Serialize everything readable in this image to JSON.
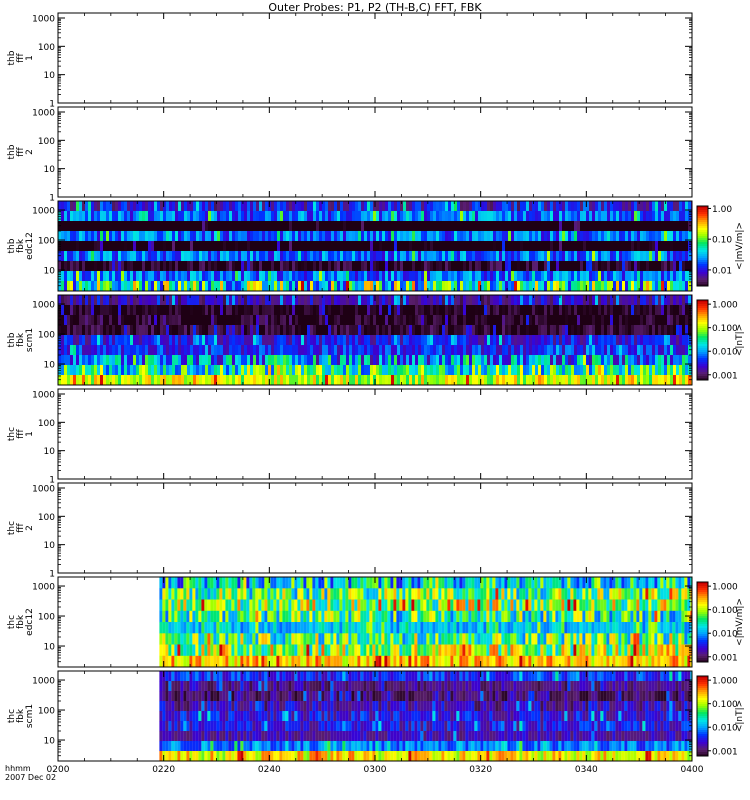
{
  "title": "Outer Probes: P1, P2 (TH-B,C) FFT, FBK",
  "colors": {
    "axis": "#000000",
    "background": "#ffffff",
    "colormap": [
      "#1e0014",
      "#5a1e6e",
      "#3c00d2",
      "#0032ff",
      "#00a0ff",
      "#00e6e6",
      "#00e664",
      "#96ff00",
      "#ffff00",
      "#ffa000",
      "#ff3200",
      "#c80000"
    ]
  },
  "chart_data": [
    {
      "type": "heatmap",
      "id": "thb_fff_1",
      "ylabel_lines": [
        "thb",
        "fff",
        "1"
      ],
      "yscale": "log",
      "ylim": [
        1,
        1500
      ],
      "yticks": [
        "1",
        "10",
        "100",
        "1000"
      ],
      "has_data": false
    },
    {
      "type": "heatmap",
      "id": "thb_fff_2",
      "ylabel_lines": [
        "thb",
        "fff",
        "2"
      ],
      "yscale": "log",
      "ylim": [
        1,
        1500
      ],
      "yticks": [
        "1",
        "10",
        "100",
        "1000"
      ],
      "has_data": false
    },
    {
      "type": "heatmap",
      "id": "thb_fbk_edc12",
      "ylabel_lines": [
        "thb",
        "fbk",
        "edc12"
      ],
      "yscale": "log",
      "ylim": [
        2,
        2000
      ],
      "yticks": [
        "10",
        "100",
        "1000"
      ],
      "has_data": true,
      "data_start_fraction": 0.0,
      "bands": [
        {
          "level": 0.01,
          "style": "blue"
        },
        {
          "level": 0.02,
          "style": "blue"
        },
        {
          "level": 0.001,
          "style": "dark"
        },
        {
          "level": 0.02,
          "style": "blue"
        },
        {
          "level": 0.002,
          "style": "dark"
        },
        {
          "level": 0.02,
          "style": "blue"
        },
        {
          "level": 0.003,
          "style": "dark"
        },
        {
          "level": 0.02,
          "style": "blue"
        },
        {
          "level": 0.06,
          "style": "mixed"
        }
      ],
      "colorbar": {
        "label": "<|mV/m|>",
        "ticks": [
          "1.00",
          "0.10",
          "0.01"
        ],
        "range": [
          0.003,
          1.2
        ]
      }
    },
    {
      "type": "heatmap",
      "id": "thb_fbk_scm1",
      "ylabel_lines": [
        "thb",
        "fbk",
        "scm1"
      ],
      "yscale": "log",
      "ylim": [
        2,
        2000
      ],
      "yticks": [
        "10",
        "100",
        "1000"
      ],
      "has_data": true,
      "data_start_fraction": 0.0,
      "bands": [
        {
          "level": 0.002,
          "style": "blue"
        },
        {
          "level": 0.0006,
          "style": "dark"
        },
        {
          "level": 0.0006,
          "style": "dark"
        },
        {
          "level": 0.0007,
          "style": "dark"
        },
        {
          "level": 0.003,
          "style": "blue"
        },
        {
          "level": 0.004,
          "style": "blue"
        },
        {
          "level": 0.01,
          "style": "mixed"
        },
        {
          "level": 0.03,
          "style": "mixed"
        },
        {
          "level": 0.1,
          "style": "bright"
        }
      ],
      "colorbar": {
        "label": "<|nT|>",
        "ticks": [
          "1.000",
          "0.100",
          "0.010",
          "0.001"
        ],
        "range": [
          0.0006,
          1.5
        ]
      }
    },
    {
      "type": "heatmap",
      "id": "thc_fff_1",
      "ylabel_lines": [
        "thc",
        "fff",
        "1"
      ],
      "yscale": "log",
      "ylim": [
        1,
        1500
      ],
      "yticks": [
        "1",
        "10",
        "100",
        "1000"
      ],
      "has_data": false
    },
    {
      "type": "heatmap",
      "id": "thc_fff_2",
      "ylabel_lines": [
        "thc",
        "fff",
        "2"
      ],
      "yscale": "log",
      "ylim": [
        1,
        1500
      ],
      "yticks": [
        "1",
        "10",
        "100",
        "1000"
      ],
      "has_data": false
    },
    {
      "type": "heatmap",
      "id": "thc_fbk_edc12",
      "ylabel_lines": [
        "thc",
        "fbk",
        "edc12"
      ],
      "yscale": "log",
      "ylim": [
        2,
        2000
      ],
      "yticks": [
        "10",
        "100",
        "1000"
      ],
      "has_data": true,
      "data_start_fraction": 0.16,
      "bands": [
        {
          "level": 0.02,
          "style": "mixed"
        },
        {
          "level": 0.05,
          "style": "mixed"
        },
        {
          "level": 0.08,
          "style": "mixed"
        },
        {
          "level": 0.04,
          "style": "mixed"
        },
        {
          "level": 0.015,
          "style": "blue"
        },
        {
          "level": 0.05,
          "style": "mixed"
        },
        {
          "level": 0.09,
          "style": "mixed"
        },
        {
          "level": 0.2,
          "style": "bright"
        }
      ],
      "colorbar": {
        "label": "<|mV/m|>",
        "ticks": [
          "1.000",
          "0.100",
          "0.010",
          "0.001"
        ],
        "range": [
          0.0006,
          1.5
        ]
      }
    },
    {
      "type": "heatmap",
      "id": "thc_fbk_scm1",
      "ylabel_lines": [
        "thc",
        "fbk",
        "scm1"
      ],
      "yscale": "log",
      "ylim": [
        2,
        2000
      ],
      "yticks": [
        "10",
        "100",
        "1000"
      ],
      "has_data": true,
      "data_start_fraction": 0.16,
      "bands": [
        {
          "level": 0.004,
          "style": "blue"
        },
        {
          "level": 0.0015,
          "style": "dark"
        },
        {
          "level": 0.0012,
          "style": "dark"
        },
        {
          "level": 0.002,
          "style": "blue"
        },
        {
          "level": 0.003,
          "style": "blue"
        },
        {
          "level": 0.003,
          "style": "blue"
        },
        {
          "level": 0.002,
          "style": "dark"
        },
        {
          "level": 0.008,
          "style": "blue"
        },
        {
          "level": 0.15,
          "style": "bright"
        }
      ],
      "colorbar": {
        "label": "<|nT|>",
        "ticks": [
          "1.000",
          "0.100",
          "0.010",
          "0.001"
        ],
        "range": [
          0.0006,
          1.5
        ]
      }
    }
  ],
  "xaxis": {
    "label_lines": [
      "hhmm",
      "2007 Dec 02"
    ],
    "ticks": [
      "0200",
      "0220",
      "0240",
      "0300",
      "0320",
      "0340",
      "0400"
    ]
  }
}
